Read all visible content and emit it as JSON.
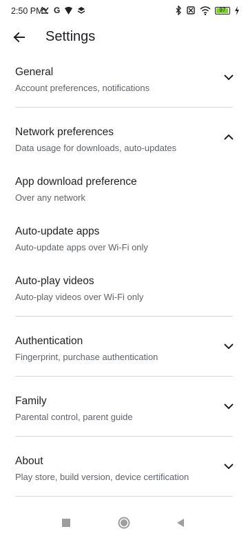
{
  "status_bar": {
    "time": "2:50 PM",
    "battery_level": "97",
    "left_icons": [
      "missed-call-icon",
      "google-icon",
      "chat-icon",
      "layers-icon"
    ],
    "right_icons": [
      "bluetooth-icon",
      "no-sim-icon",
      "wifi-icon",
      "battery-icon",
      "charging-icon"
    ],
    "battery_color": "#7cd321"
  },
  "app_bar": {
    "title": "Settings",
    "back_icon": "back-arrow-icon"
  },
  "sections": [
    {
      "title": "General",
      "subtitle": "Account preferences, notifications",
      "expanded": false
    },
    {
      "title": "Network preferences",
      "subtitle": "Data usage for downloads, auto-updates",
      "expanded": true,
      "items": [
        {
          "title": "App download preference",
          "subtitle": "Over any network"
        },
        {
          "title": "Auto-update apps",
          "subtitle": "Auto-update apps over Wi-Fi only"
        },
        {
          "title": "Auto-play videos",
          "subtitle": "Auto-play videos over Wi-Fi only"
        }
      ]
    },
    {
      "title": "Authentication",
      "subtitle": "Fingerprint, purchase authentication",
      "expanded": false
    },
    {
      "title": "Family",
      "subtitle": "Parental control, parent guide",
      "expanded": false
    },
    {
      "title": "About",
      "subtitle": "Play store, build version, device certification",
      "expanded": false
    }
  ],
  "nav_bar": {
    "buttons": [
      "recents-square-icon",
      "home-circle-icon",
      "back-triangle-icon"
    ]
  }
}
